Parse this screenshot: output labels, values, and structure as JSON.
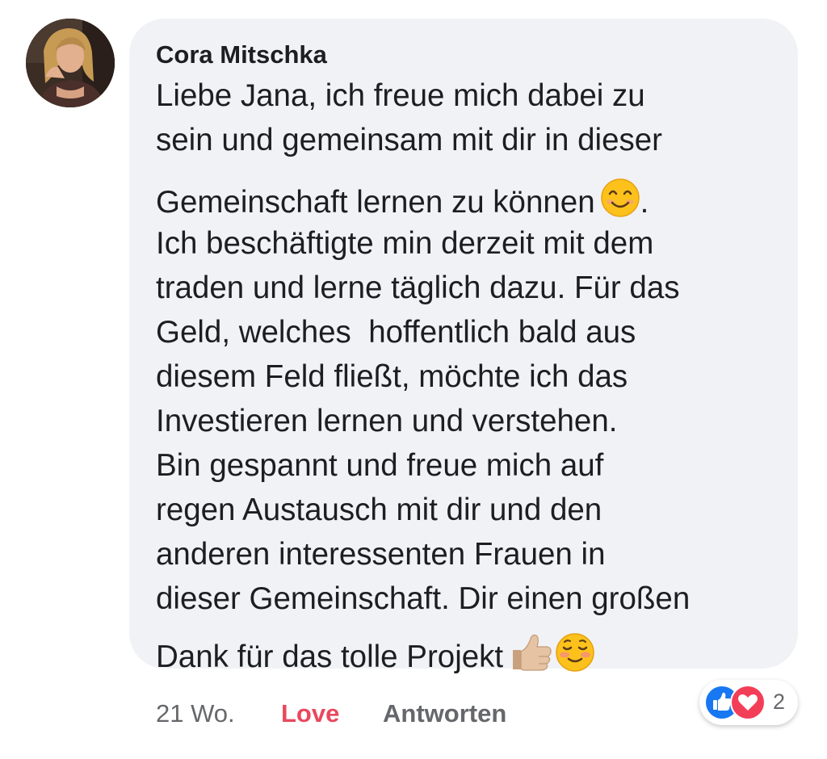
{
  "comment": {
    "author": "Cora Mitschka",
    "lines": [
      "Liebe Jana, ich freue mich dabei zu",
      "sein und gemeinsam mit dir in dieser",
      "Gemeinschaft lernen zu können",
      ".",
      "Ich beschäftigte min derzeit mit dem",
      "traden und lerne täglich dazu. Für das",
      "Geld, welches  hoffentlich bald aus",
      "diesem Feld fließt, möchte ich das",
      "Investieren lernen und verstehen.",
      "Bin gespannt und freue mich auf",
      "regen Austausch mit dir und den",
      "anderen interessenten Frauen in",
      "dieser Gemeinschaft. Dir einen großen",
      "Dank für das tolle Projekt"
    ],
    "emojis": [
      "smiling-face-with-smiling-eyes",
      "thumbs-up-light-skin",
      "smiling-face-blushing"
    ]
  },
  "meta": {
    "time": "21 Wo.",
    "love_label": "Love",
    "reply_label": "Antworten"
  },
  "reactions": {
    "count": "2",
    "icons": [
      "like-icon",
      "love-icon"
    ]
  },
  "colors": {
    "bubble_bg": "#f0f2f5",
    "text": "#1c1e21",
    "secondary_text": "#65676b",
    "love_red": "#e9485f",
    "like_blue": "#1877f2"
  }
}
